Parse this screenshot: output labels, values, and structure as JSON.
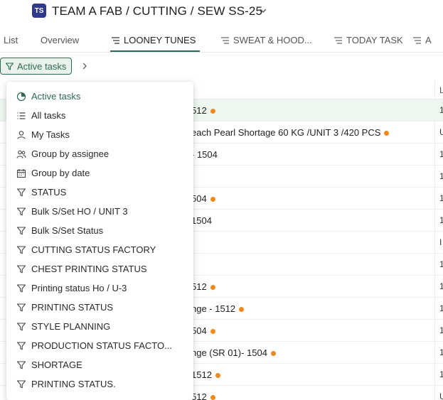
{
  "header": {
    "avatar_initials": "TS",
    "title": "TEAM A FAB / CUTTING / SEW SS-25"
  },
  "tabs": [
    {
      "label": "List",
      "icon": null,
      "active": false
    },
    {
      "label": "Overview",
      "icon": null,
      "active": false
    },
    {
      "label": "LOONEY TUNES",
      "icon": "list-view-icon",
      "active": true
    },
    {
      "label": "SWEAT & HOOD...",
      "icon": "list-view-icon",
      "active": false
    },
    {
      "label": "TODAY TASK",
      "icon": "list-view-icon",
      "active": false
    },
    {
      "label": "A",
      "icon": "list-view-icon",
      "active": false
    }
  ],
  "filter": {
    "label": "Active tasks"
  },
  "table": {
    "column_letter": "L",
    "rows": [
      {
        "text": "512",
        "dot": true,
        "end": "1",
        "highlight": true
      },
      {
        "text": "each Pearl Shortage 60 KG /UNIT 3 /420 PCS",
        "dot": true,
        "end": "U",
        "highlight": false
      },
      {
        "text": "- 1504",
        "dot": false,
        "end": "1",
        "highlight": false
      },
      {
        "text": "",
        "dot": false,
        "end": "1",
        "highlight": false
      },
      {
        "text": "504",
        "dot": true,
        "end": "1",
        "highlight": false
      },
      {
        "text": "1504",
        "dot": false,
        "end": "1",
        "highlight": false
      },
      {
        "text": "",
        "dot": false,
        "end": "I",
        "highlight": false
      },
      {
        "text": "",
        "dot": false,
        "end": "1",
        "highlight": false
      },
      {
        "text": "512",
        "dot": true,
        "end": "1",
        "highlight": false
      },
      {
        "text": "nge - 1512",
        "dot": true,
        "end": "1",
        "highlight": false
      },
      {
        "text": "504",
        "dot": true,
        "end": "1",
        "highlight": false
      },
      {
        "text": "nge (SR 01)- 1504",
        "dot": true,
        "end": "1",
        "highlight": false
      },
      {
        "text": "1512",
        "dot": true,
        "end": "1",
        "highlight": false
      },
      {
        "text": "512",
        "dot": true,
        "end": "U",
        "highlight": false
      }
    ]
  },
  "menu": {
    "items": [
      {
        "label": "Active tasks",
        "icon": "pie-chart-icon",
        "active": true
      },
      {
        "label": "All tasks",
        "icon": "list-icon",
        "active": false
      },
      {
        "label": "My Tasks",
        "icon": "user-icon",
        "active": false
      },
      {
        "label": "Group by assignee",
        "icon": "users-icon",
        "active": false
      },
      {
        "label": "Group by date",
        "icon": "calendar-icon",
        "active": false
      },
      {
        "label": "STATUS",
        "icon": "filter-icon",
        "active": false
      },
      {
        "label": "Bulk S/Set HO / UNIT 3",
        "icon": "filter-icon",
        "active": false
      },
      {
        "label": "Bulk S/Set Status",
        "icon": "filter-icon",
        "active": false
      },
      {
        "label": "CUTTING STATUS FACTORY",
        "icon": "filter-icon",
        "active": false
      },
      {
        "label": "CHEST PRINTING STATUS",
        "icon": "filter-icon",
        "active": false
      },
      {
        "label": "Printing status Ho / U-3",
        "icon": "filter-icon",
        "active": false
      },
      {
        "label": "PRINTING STATUS",
        "icon": "filter-icon",
        "active": false
      },
      {
        "label": "STYLE PLANNING",
        "icon": "filter-icon",
        "active": false
      },
      {
        "label": "PRODUCTION STATUS FACTO...",
        "icon": "filter-icon",
        "active": false
      },
      {
        "label": "SHORTAGE",
        "icon": "filter-icon",
        "active": false
      },
      {
        "label": "PRINTING STATUS.",
        "icon": "filter-icon",
        "active": false
      }
    ]
  },
  "colors": {
    "accent": "#2e6b4f",
    "avatar_bg": "#2f3a8f",
    "dot": "#ee8a1e",
    "highlight_row": "#eef6f0"
  }
}
